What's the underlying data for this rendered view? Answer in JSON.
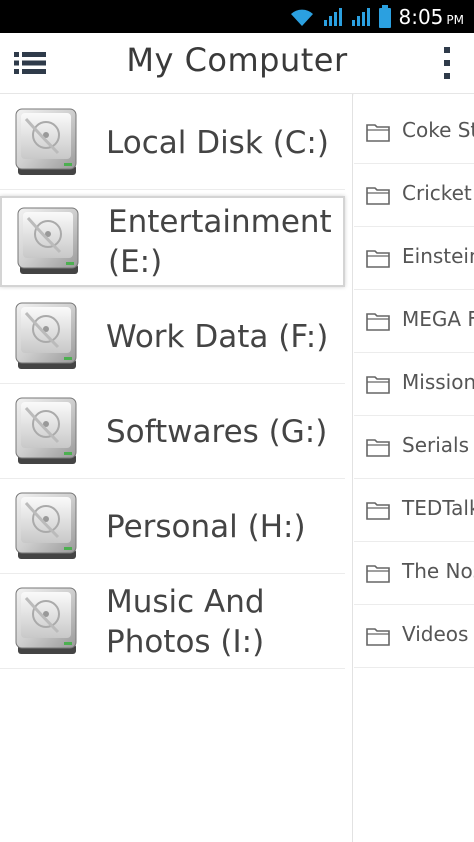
{
  "status_bar": {
    "time": "8:05",
    "ampm": "PM",
    "icons": [
      "wifi-icon",
      "signal-icon",
      "signal-icon-2",
      "battery-icon"
    ],
    "icon_color": "#2ba0e0"
  },
  "app_bar": {
    "title": "My Computer",
    "menu_icon": "list-menu-icon",
    "overflow_icon": "more-vert-icon"
  },
  "drives": [
    {
      "label": "Local Disk (C:)",
      "selected": false
    },
    {
      "label": "Entertainment (E:)",
      "selected": true
    },
    {
      "label": "Work Data (F:)",
      "selected": false
    },
    {
      "label": "Softwares (G:)",
      "selected": false
    },
    {
      "label": "Personal (H:)",
      "selected": false
    },
    {
      "label": "Music And Photos (I:)",
      "selected": false
    }
  ],
  "folders": [
    {
      "label": "Coke Studio"
    },
    {
      "label": "Cricket"
    },
    {
      "label": "Einstein"
    },
    {
      "label": "MEGA Factories"
    },
    {
      "label": "Mission"
    },
    {
      "label": "Serials"
    },
    {
      "label": "TEDTalks"
    },
    {
      "label": "The Nostalgia"
    },
    {
      "label": "Videos"
    }
  ]
}
